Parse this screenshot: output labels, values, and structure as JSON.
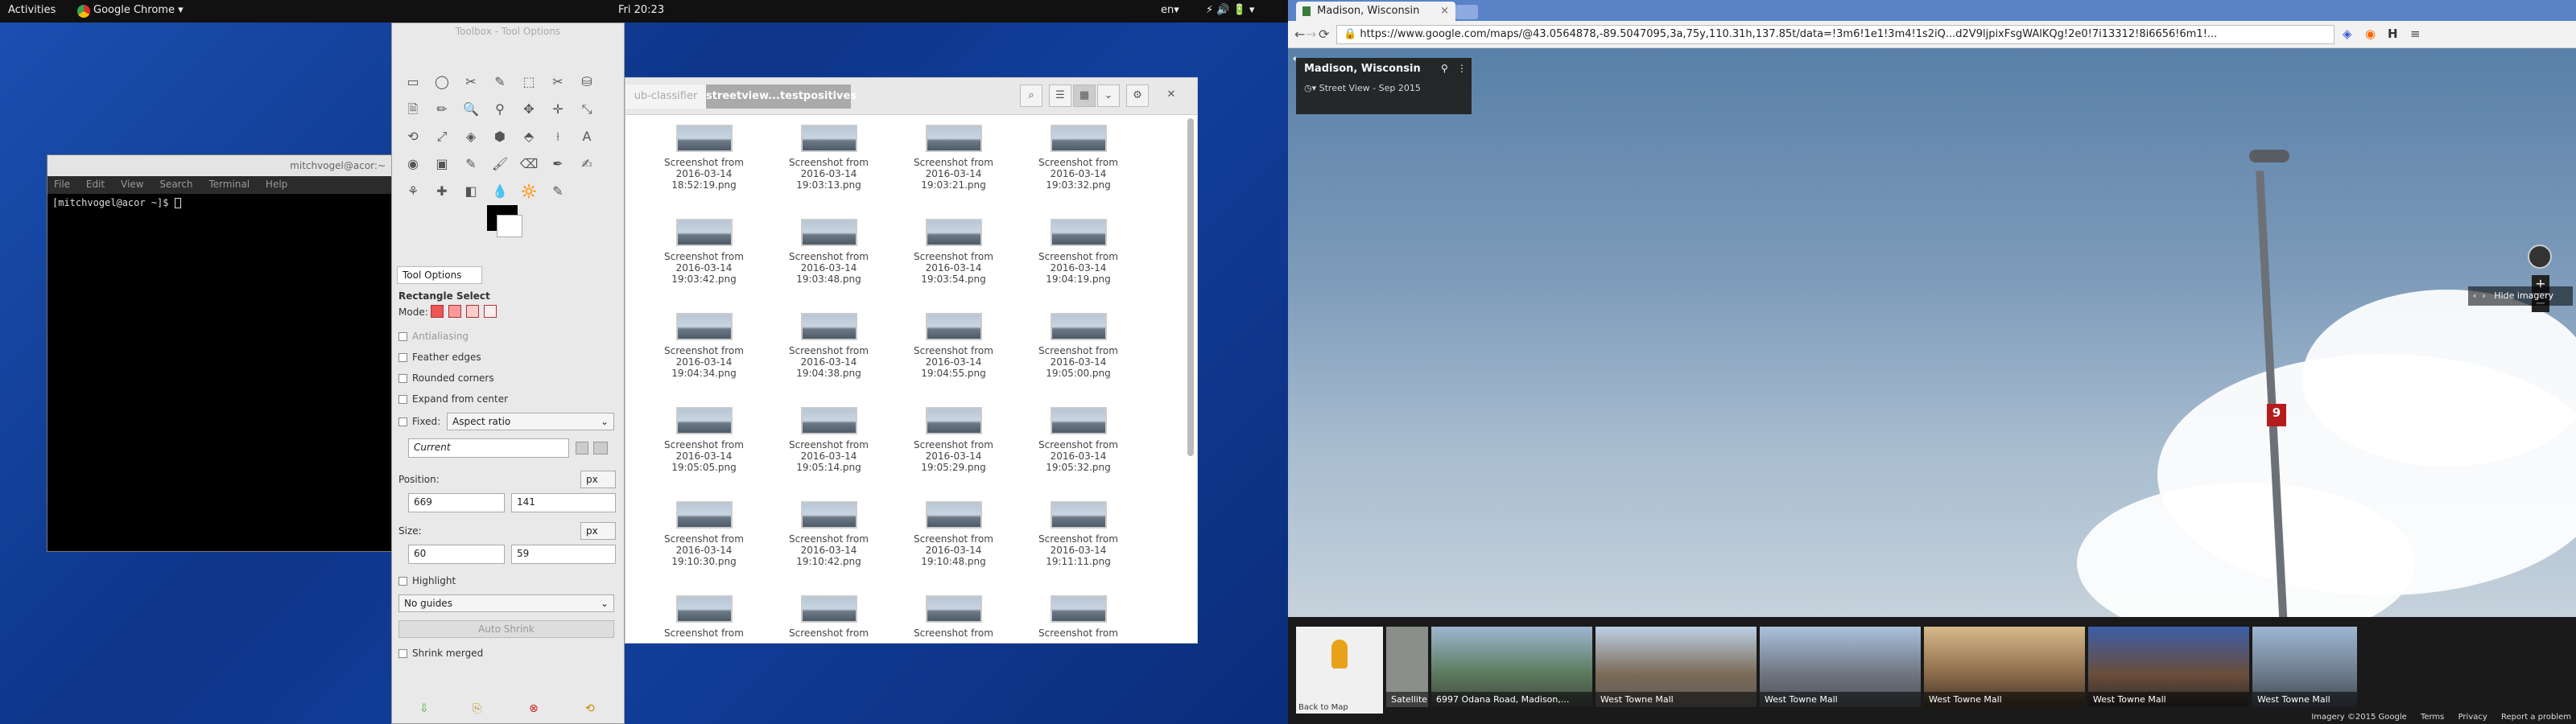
{
  "topbar": {
    "activities": "Activities",
    "app": "Google Chrome ▾",
    "clock": "Fri 20:23",
    "lang": "en▾",
    "sys": "⚡ 🔊 🔋 ▾"
  },
  "terminal": {
    "title": "mitchvogel@acor:~",
    "menu": [
      "File",
      "Edit",
      "View",
      "Search",
      "Terminal",
      "Help"
    ],
    "prompt": "[mitchvogel@acor ~]$ "
  },
  "toolbox": {
    "title": "Toolbox - Tool Options",
    "tools": [
      "▭",
      "◯",
      "✂",
      "✎",
      "⬚",
      "✂",
      "⛁",
      "🗎",
      "✏",
      "🔍",
      "⚲",
      "✥",
      "✛",
      "⤡",
      "⟲",
      "⤢",
      "◈",
      "⬢",
      "⬘",
      "⟊",
      "A",
      "◉",
      "▣",
      "✎",
      "🖌",
      "⌫",
      "✒",
      "✍",
      "⚘",
      "✚",
      "◧",
      "💧",
      "🔆",
      "✎"
    ],
    "tab": "Tool Options",
    "heading": "Rectangle Select",
    "mode": "Mode:",
    "antialias": "Antialiasing",
    "feather": "Feather edges",
    "rounded": "Rounded corners",
    "expand": "Expand from center",
    "fixed": "Fixed:",
    "fixed_value": "Aspect ratio",
    "current": "Current",
    "position_label": "Position:",
    "pos_x": "669",
    "pos_y": "141",
    "unit": "px",
    "size_label": "Size:",
    "size_w": "60",
    "size_h": "59",
    "highlight": "Highlight",
    "guides": "No guides",
    "auto_shrink": "Auto Shrink",
    "shrink_merged": "Shrink merged"
  },
  "files": {
    "tab_inactive": "ub-classifier",
    "tab_active": "streetview...testpositives",
    "items": [
      [
        "Screenshot from",
        "2016-03-14",
        "18:52:19.png"
      ],
      [
        "Screenshot from",
        "2016-03-14",
        "19:03:13.png"
      ],
      [
        "Screenshot from",
        "2016-03-14",
        "19:03:21.png"
      ],
      [
        "Screenshot from",
        "2016-03-14",
        "19:03:32.png"
      ],
      [
        "Screenshot from",
        "2016-03-14",
        "19:03:42.png"
      ],
      [
        "Screenshot from",
        "2016-03-14",
        "19:03:48.png"
      ],
      [
        "Screenshot from",
        "2016-03-14",
        "19:03:54.png"
      ],
      [
        "Screenshot from",
        "2016-03-14",
        "19:04:19.png"
      ],
      [
        "Screenshot from",
        "2016-03-14",
        "19:04:34.png"
      ],
      [
        "Screenshot from",
        "2016-03-14",
        "19:04:38.png"
      ],
      [
        "Screenshot from",
        "2016-03-14",
        "19:04:55.png"
      ],
      [
        "Screenshot from",
        "2016-03-14",
        "19:05:00.png"
      ],
      [
        "Screenshot from",
        "2016-03-14",
        "19:05:05.png"
      ],
      [
        "Screenshot from",
        "2016-03-14",
        "19:05:14.png"
      ],
      [
        "Screenshot from",
        "2016-03-14",
        "19:05:29.png"
      ],
      [
        "Screenshot from",
        "2016-03-14",
        "19:05:32.png"
      ],
      [
        "Screenshot from",
        "2016-03-14",
        "19:10:30.png"
      ],
      [
        "Screenshot from",
        "2016-03-14",
        "19:10:42.png"
      ],
      [
        "Screenshot from",
        "2016-03-14",
        "19:10:48.png"
      ],
      [
        "Screenshot from",
        "2016-03-14",
        "19:11:11.png"
      ],
      [
        "Screenshot from",
        "",
        ""
      ],
      [
        "Screenshot from",
        "",
        ""
      ],
      [
        "Screenshot from",
        "",
        ""
      ],
      [
        "Screenshot from",
        "",
        ""
      ]
    ]
  },
  "chrome": {
    "tab_title": "Madison, Wisconsin",
    "url": "https://www.google.com/maps/@43.0564878,-89.5047095,3a,75y,110.31h,137.85t/data=!3m6!1e1!3m4!1s2iQ...d2V9ljpixFsgWAlKQg!2e0!7i13312!8i6656!6m1!...",
    "place": "Madison, Wisconsin",
    "date": "Street View - Sep 2015",
    "sign_number": "9",
    "hide_imagery": "Hide imagery",
    "back_to_map": "Back to Map",
    "strip": [
      "Satellite",
      "6997 Odana Road, Madison,...",
      "West Towne Mall",
      "West Towne Mall",
      "West Towne Mall",
      "West Towne Mall",
      "West Towne Mall"
    ],
    "footer": [
      "Imagery ©2015 Google",
      "Terms",
      "Privacy",
      "Report a problem"
    ]
  }
}
